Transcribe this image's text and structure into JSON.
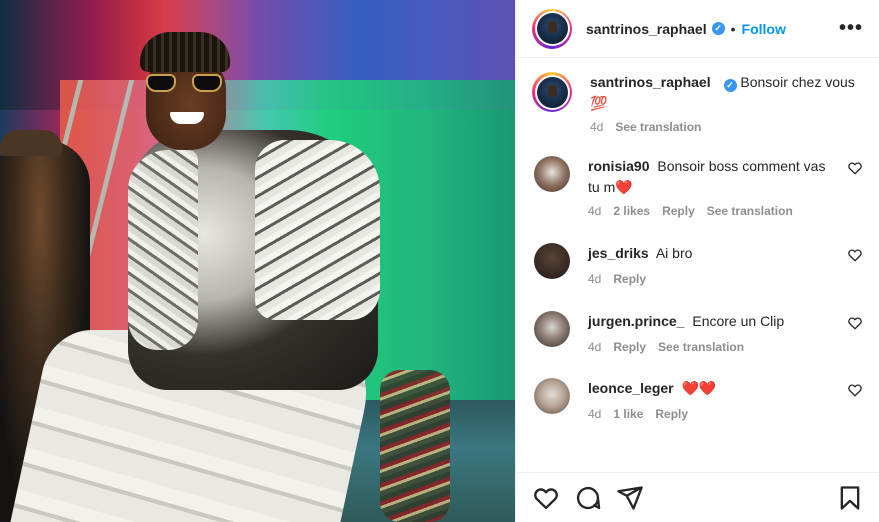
{
  "header": {
    "username": "santrinos_raphael",
    "verified": true,
    "separator": "•",
    "follow_label": "Follow",
    "more_label": "•••"
  },
  "caption": {
    "username": "santrinos_raphael",
    "text": "Bonsoir chez vous",
    "emoji": "💯",
    "time": "4d",
    "see_translation": "See translation"
  },
  "comments": [
    {
      "username": "ronisia90",
      "text": "Bonsoir boss comment vas tu m",
      "emoji": "❤️",
      "time": "4d",
      "likes": "2 likes",
      "reply": "Reply",
      "see_translation": "See translation"
    },
    {
      "username": "jes_driks",
      "text": "Ai bro",
      "time": "4d",
      "reply": "Reply"
    },
    {
      "username": "jurgen.prince_",
      "text": "Encore un Clip",
      "time": "4d",
      "reply": "Reply",
      "see_translation": "See translation"
    },
    {
      "username": "leonce_leger",
      "text": "",
      "emoji": "❤️❤️",
      "time": "4d",
      "likes": "1 like",
      "reply": "Reply"
    }
  ],
  "colors": {
    "accent": "#0095f6",
    "verified": "#3897f0",
    "muted": "#8e8e8e"
  },
  "icons": [
    "like-icon",
    "comment-icon",
    "share-icon",
    "save-icon",
    "heart-icon",
    "verified-badge-icon"
  ]
}
